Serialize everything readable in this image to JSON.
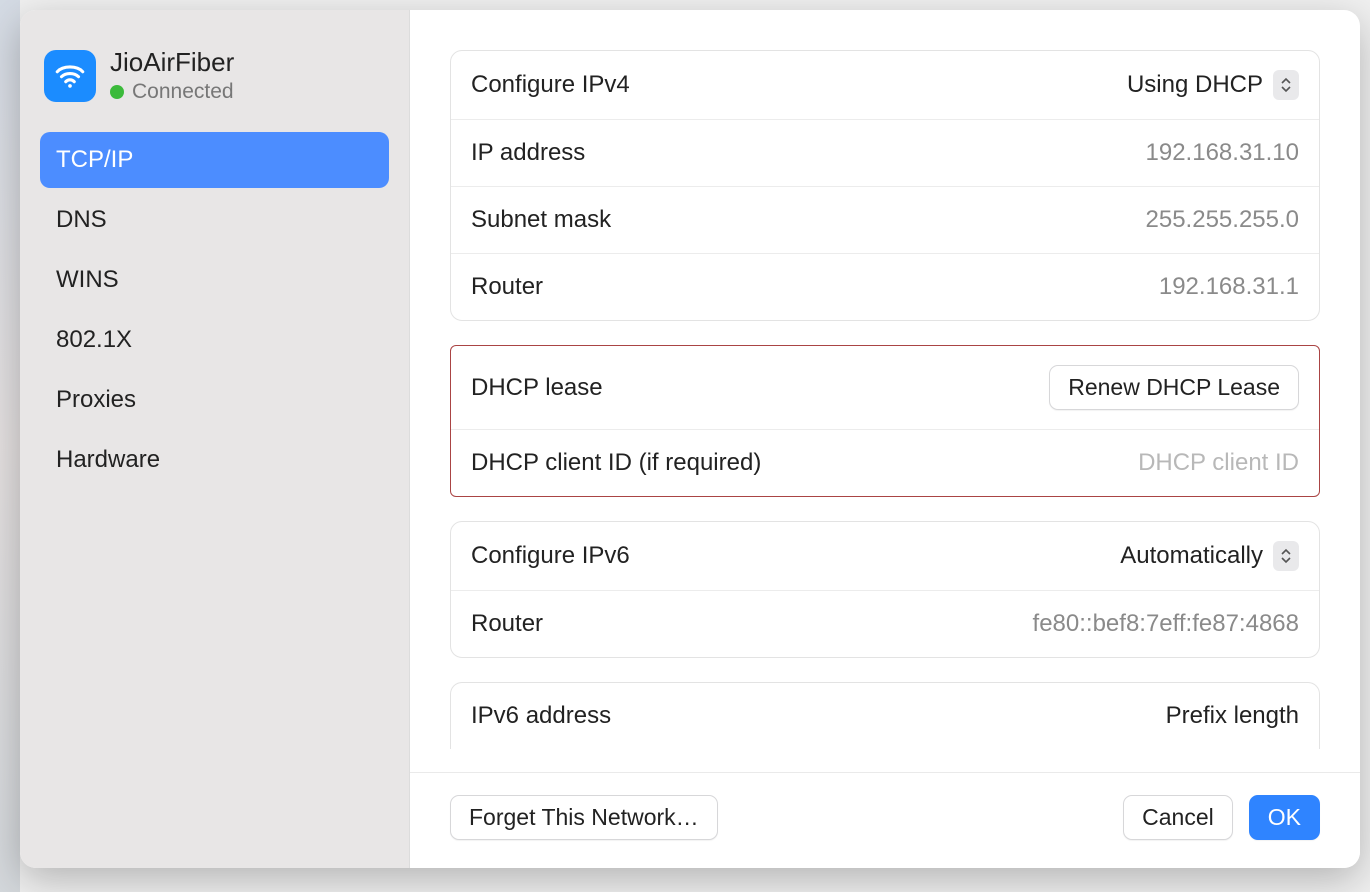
{
  "sidebar": {
    "network_name": "JioAirFiber",
    "status_text": "Connected",
    "items": [
      {
        "label": "TCP/IP",
        "active": true
      },
      {
        "label": "DNS",
        "active": false
      },
      {
        "label": "WINS",
        "active": false
      },
      {
        "label": "802.1X",
        "active": false
      },
      {
        "label": "Proxies",
        "active": false
      },
      {
        "label": "Hardware",
        "active": false
      }
    ]
  },
  "ipv4": {
    "configure_label": "Configure IPv4",
    "configure_value": "Using DHCP",
    "ip_label": "IP address",
    "ip_value": "192.168.31.10",
    "subnet_label": "Subnet mask",
    "subnet_value": "255.255.255.0",
    "router_label": "Router",
    "router_value": "192.168.31.1"
  },
  "dhcp": {
    "lease_label": "DHCP lease",
    "renew_button": "Renew DHCP Lease",
    "client_id_label": "DHCP client ID (if required)",
    "client_id_placeholder": "DHCP client ID"
  },
  "ipv6": {
    "configure_label": "Configure IPv6",
    "configure_value": "Automatically",
    "router_label": "Router",
    "router_value": "fe80::bef8:7eff:fe87:4868",
    "addr_label": "IPv6 address",
    "prefix_label": "Prefix length"
  },
  "footer": {
    "forget": "Forget This Network…",
    "cancel": "Cancel",
    "ok": "OK"
  }
}
